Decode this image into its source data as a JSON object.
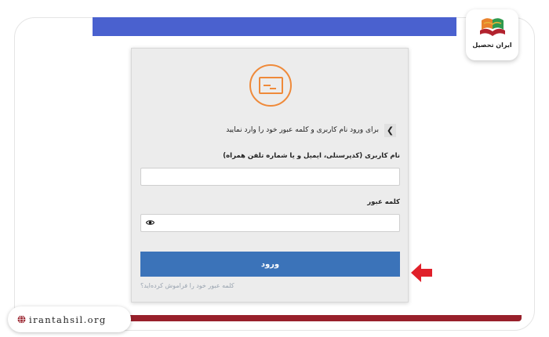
{
  "login": {
    "prompt": "برای ورود نام کاربری و کلمه عبور خود را وارد نمایید",
    "username_label": "نام کاربری (کدپرسنلی، ایمیل و یا شماره تلفن همراه)",
    "username_value": "",
    "password_label": "کلمه عبور",
    "password_value": "",
    "submit_label": "ورود",
    "forgot_link": "کلمه عبور خود را فراموش کرده‌اید؟"
  },
  "brand": {
    "name": "ایران تحصیل",
    "website": "irantahsil.org"
  },
  "colors": {
    "accent_blue": "#4a61cf",
    "button_blue": "#3b73b9",
    "logo_orange": "#ef8a3a",
    "arrow_red": "#e0202a",
    "brand_maroon": "#98202b"
  },
  "icons": {
    "logo": "card-icon",
    "back": "chevron-left-icon",
    "password_visibility": "eye-icon",
    "pointer": "arrow-left-icon",
    "brand": "book-icon",
    "website": "globe-icon"
  }
}
